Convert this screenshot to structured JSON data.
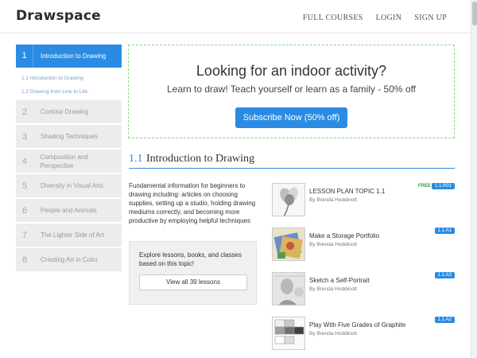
{
  "header": {
    "logo": "Drawspace",
    "nav": [
      "FULL COURSES",
      "LOGIN",
      "SIGN UP"
    ]
  },
  "sidebar": {
    "items": [
      {
        "num": "1",
        "label": "Introduction to Drawing",
        "active": true
      },
      {
        "num": "2",
        "label": "Contour Drawing"
      },
      {
        "num": "3",
        "label": "Shading Techniques"
      },
      {
        "num": "4",
        "label": "Composition and Perspective"
      },
      {
        "num": "5",
        "label": "Diversity in Visual Arts"
      },
      {
        "num": "6",
        "label": "People and Animals"
      },
      {
        "num": "7",
        "label": "The Lighter Side of Art"
      },
      {
        "num": "8",
        "label": "Creating Art in Color"
      }
    ],
    "subitems": [
      "1.1 Introduction to Drawing",
      "1.2 Drawing from Line to Life:"
    ]
  },
  "promo": {
    "headline": "Looking for an indoor activity?",
    "subline": "Learn to draw! Teach yourself or learn as a family - 50% off",
    "button": "Subscribe Now (50% off)",
    "accent": "#2b8be3"
  },
  "section": {
    "number": "1.1",
    "title": "Introduction to Drawing",
    "description": "Fundamental information for beginners to drawing including: articles on choosing supplies, setting up a studio, holding drawing mediums correctly, and becoming more productive by employing helpful techniques",
    "explore_text": "Explore lessons, books, and classes based on this topic!",
    "view_all": "View all 39 lessons"
  },
  "lessons": [
    {
      "title": "LESSON PLAN TOPIC 1.1",
      "author": "By Brenda Hoddinott",
      "badge": "1.1.R01",
      "free": "FREE",
      "icon": "flower-thumbnail"
    },
    {
      "title": "Make a Storage Portfolio",
      "author": "By Brenda Hoddinott",
      "badge": "1.1.A1",
      "icon": "portfolio-thumbnail"
    },
    {
      "title": "Sketch a Self-Portrait",
      "author": "By Brenda Hoddinott",
      "badge": "1.1.A3",
      "icon": "portrait-thumbnail"
    },
    {
      "title": "Play With Five Grades of Graphite",
      "author": "By Brenda Hoddinott",
      "badge": "1.1.A2",
      "icon": "graphite-grid-thumbnail"
    }
  ]
}
